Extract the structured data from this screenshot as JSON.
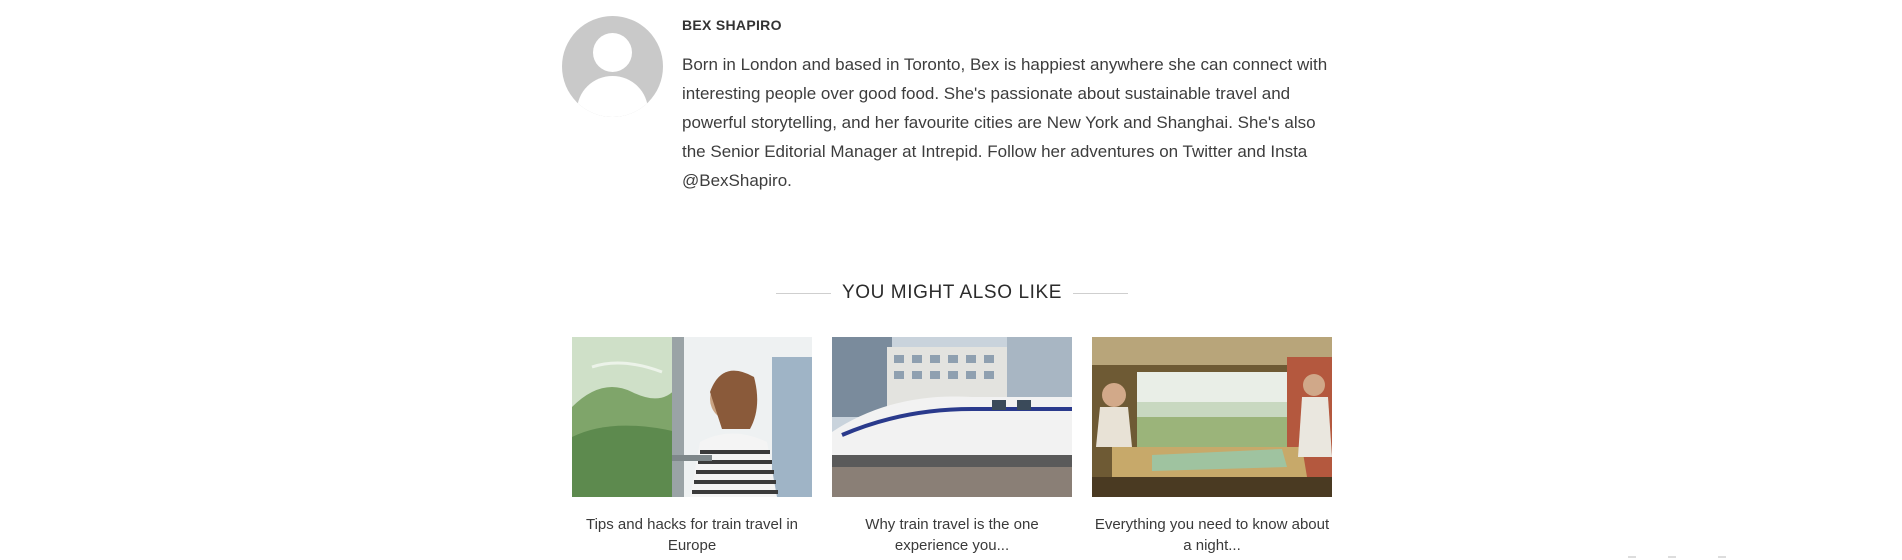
{
  "author": {
    "name": "BEX SHAPIRO",
    "bio": "Born in London and based in Toronto, Bex is happiest anywhere she can connect with interesting people over good food. She's passionate about sustainable travel and powerful storytelling, and her favourite cities are New York and Shanghai. She's also the Senior Editorial Manager at Intrepid. Follow her adventures on Twitter and Insta @BexShapiro.",
    "avatar_icon": "default-user-avatar-icon"
  },
  "related": {
    "heading": "YOU MIGHT ALSO LIKE",
    "cards": [
      {
        "caption": "Tips and hacks for train travel in Europe",
        "image": "woman-leaning-on-train-window-photo"
      },
      {
        "caption": "Why train travel is the one experience you...",
        "image": "bullet-train-in-city-photo"
      },
      {
        "caption": "Everything you need to know about a night...",
        "image": "passengers-in-sleeper-train-cabin-photo"
      }
    ]
  },
  "colors": {
    "text": "#333333",
    "avatar_bg": "#c9c9c9",
    "rule": "#cfcfcf"
  }
}
